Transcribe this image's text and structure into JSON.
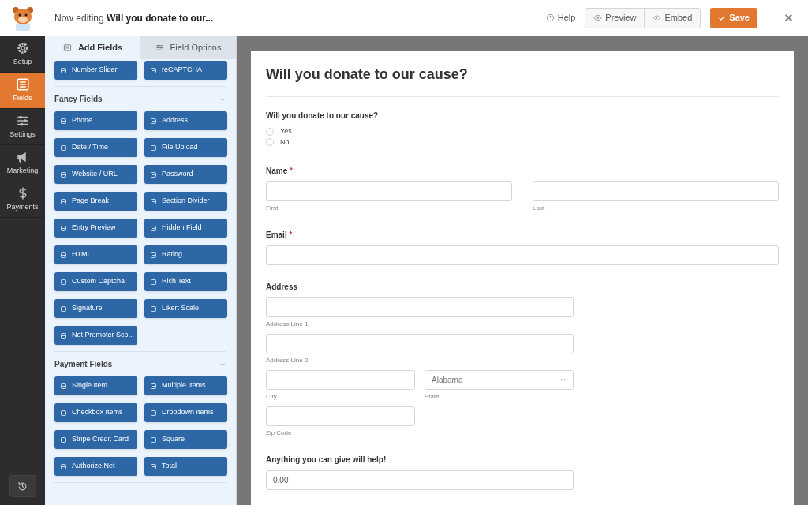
{
  "header": {
    "prefix": "Now editing",
    "form_name": "Will you donate to our...",
    "help": "Help",
    "preview": "Preview",
    "embed": "Embed",
    "save": "Save"
  },
  "nav": [
    {
      "label": "Setup",
      "selected": false
    },
    {
      "label": "Fields",
      "selected": true
    },
    {
      "label": "Settings",
      "selected": false
    },
    {
      "label": "Marketing",
      "selected": false
    },
    {
      "label": "Payments",
      "selected": false
    }
  ],
  "panel_tabs": [
    {
      "label": "Add Fields",
      "selected": true
    },
    {
      "label": "Field Options",
      "selected": false
    }
  ],
  "cut_row": [
    "Number Slider",
    "reCAPTCHA"
  ],
  "groups": [
    {
      "title": "Fancy Fields",
      "fields": [
        "Phone",
        "Address",
        "Date / Time",
        "File Upload",
        "Website / URL",
        "Password",
        "Page Break",
        "Section Divider",
        "Entry Preview",
        "Hidden Field",
        "HTML",
        "Rating",
        "Custom Captcha",
        "Rich Text",
        "Signature",
        "Likert Scale",
        "Net Promoter Sco..."
      ]
    },
    {
      "title": "Payment Fields",
      "fields": [
        "Single Item",
        "Multiple Items",
        "Checkbox Items",
        "Dropdown Items",
        "Stripe Credit Card",
        "Square",
        "Authorize.Net",
        "Total"
      ]
    }
  ],
  "form": {
    "title": "Will you donate to our cause?",
    "fields": [
      {
        "kind": "radio",
        "label": "Will you donate to our cause?",
        "options": [
          {
            "label": "Yes",
            "selected": false
          },
          {
            "label": "No",
            "selected": false
          }
        ]
      },
      {
        "kind": "name",
        "label": "Name",
        "required_mark": "*",
        "sublabels": [
          "First",
          "Last"
        ]
      },
      {
        "kind": "text",
        "label": "Email",
        "required_mark": "*"
      },
      {
        "kind": "address",
        "label": "Address",
        "sublabels": [
          "Address Line 1",
          "Address Line 2",
          "City",
          "State",
          "Zip Code"
        ],
        "state_value": "Alabama"
      },
      {
        "kind": "value",
        "label": "Anything you can give will help!",
        "value": "0.00"
      }
    ]
  }
}
